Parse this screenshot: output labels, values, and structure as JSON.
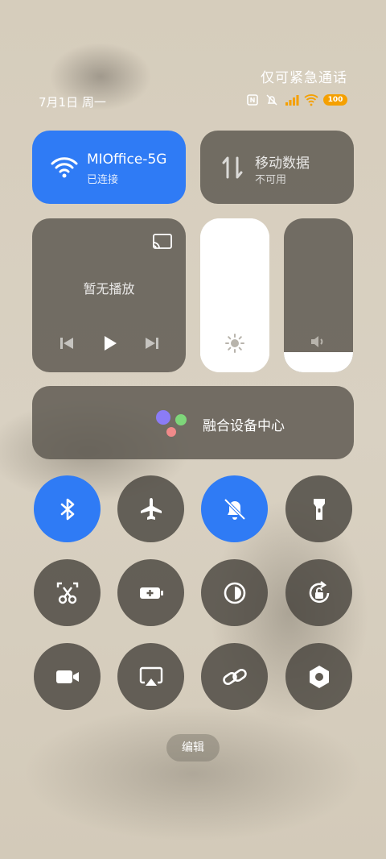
{
  "status_bar": {
    "carrier_text": "仅可紧急通话",
    "date": "7月1日 周一",
    "battery": "100",
    "icons": [
      "nfc-icon",
      "alarm-off-icon",
      "signal-icon",
      "wifi-status-icon",
      "battery-icon"
    ]
  },
  "wifi_tile": {
    "title": "MIOffice-5G",
    "subtitle": "已连接",
    "icon": "wifi-icon",
    "active": true,
    "color": "#2f7bf5"
  },
  "data_tile": {
    "title": "移动数据",
    "subtitle": "不可用",
    "icon": "mobile-data-icon",
    "active": false
  },
  "media": {
    "label": "暂无播放",
    "icons": [
      "cast-icon",
      "prev-icon",
      "play-icon",
      "next-icon"
    ]
  },
  "brightness": {
    "level": 1.0,
    "icon": "sun-icon"
  },
  "volume": {
    "level": 0.13,
    "icon": "speaker-icon"
  },
  "device_hub": {
    "label": "融合设备中心",
    "dot_colors": [
      "#8b7cf6",
      "#7ed67a",
      "#f08a8a"
    ]
  },
  "toggles": [
    {
      "name": "bluetooth",
      "icon": "bluetooth-icon",
      "active": true
    },
    {
      "name": "airplane-mode",
      "icon": "airplane-icon",
      "active": false
    },
    {
      "name": "mute",
      "icon": "bell-off-icon",
      "active": true
    },
    {
      "name": "flashlight",
      "icon": "flashlight-icon",
      "active": false
    },
    {
      "name": "screenshot",
      "icon": "scissors-icon",
      "active": false
    },
    {
      "name": "battery-saver",
      "icon": "battery-plus-icon",
      "active": false
    },
    {
      "name": "dark-mode",
      "icon": "contrast-icon",
      "active": false
    },
    {
      "name": "rotation-lock",
      "icon": "rotate-lock-icon",
      "active": false
    },
    {
      "name": "screen-record",
      "icon": "video-icon",
      "active": false
    },
    {
      "name": "screen-cast",
      "icon": "airplay-icon",
      "active": false
    },
    {
      "name": "link",
      "icon": "link-icon",
      "active": false
    },
    {
      "name": "settings",
      "icon": "hexagon-gear-icon",
      "active": false
    }
  ],
  "edit_button": {
    "label": "编辑"
  },
  "colors": {
    "accent": "#2f7bf5",
    "tile_inactive": "#5f5a52"
  }
}
